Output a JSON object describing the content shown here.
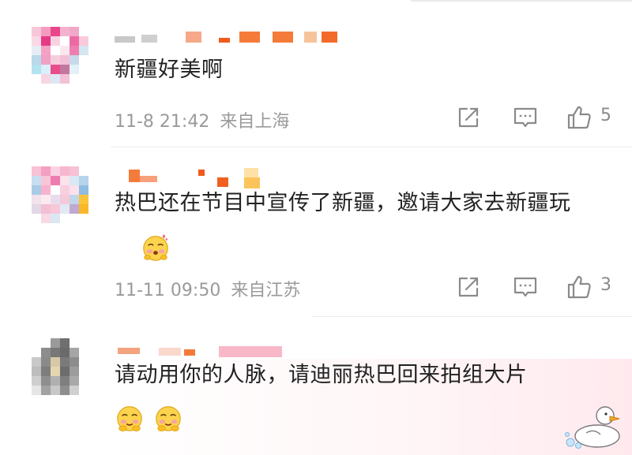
{
  "comments": [
    {
      "text": "新疆好美啊",
      "time": "11-8 21:42",
      "location": "来自上海",
      "likes": "5"
    },
    {
      "text": "热巴还在节目中宣传了新疆，邀请大家去新疆玩",
      "time": "11-11 09:50",
      "location": "来自江苏",
      "likes": "3"
    },
    {
      "text": "请动用你的人脉，请迪丽热巴回来拍组大片"
    }
  ],
  "icons": {
    "share": "share-icon",
    "reply": "comment-icon",
    "like": "thumbs-up-icon",
    "emoji": "blush-emoji-icon",
    "duck": "duck-sticker-icon"
  },
  "colors": {
    "text": "#222222",
    "meta": "#9a9a9a",
    "icon": "#8a8a8a",
    "divider": "#ececec"
  }
}
